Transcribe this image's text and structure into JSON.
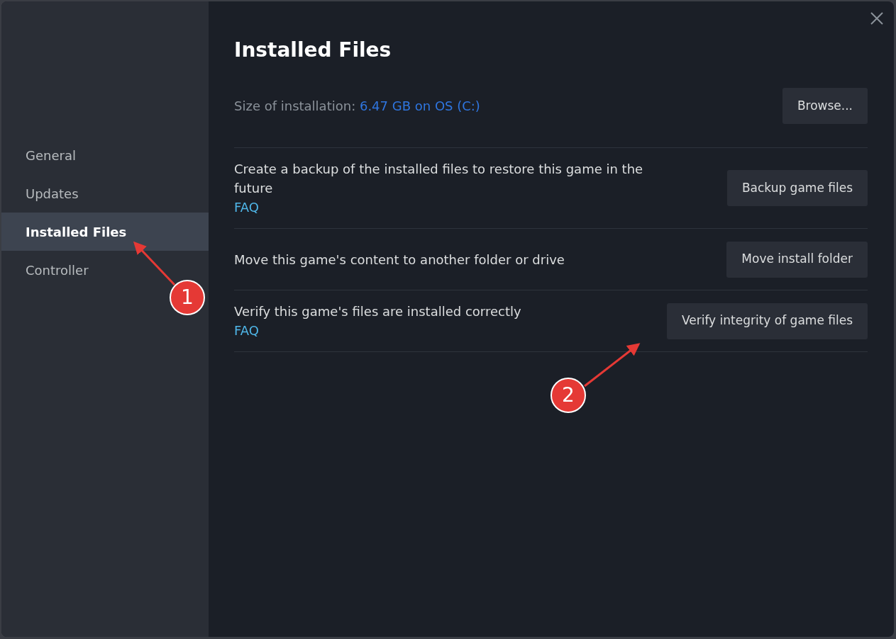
{
  "sidebar": {
    "items": [
      {
        "label": "General",
        "selected": false
      },
      {
        "label": "Updates",
        "selected": false
      },
      {
        "label": "Installed Files",
        "selected": true
      },
      {
        "label": "Controller",
        "selected": false
      }
    ]
  },
  "title": "Installed Files",
  "size": {
    "label": "Size of installation:",
    "value": "6.47 GB on OS (C:)",
    "button": "Browse..."
  },
  "rows": [
    {
      "description": "Create a backup of the installed files to restore this game in the future",
      "link": "FAQ",
      "button": "Backup game files"
    },
    {
      "description": "Move this game's content to another folder or drive",
      "button": "Move install folder"
    },
    {
      "description": "Verify this game's files are installed correctly",
      "link": "FAQ",
      "button": "Verify integrity of game files"
    }
  ],
  "callouts": [
    "1",
    "2"
  ]
}
